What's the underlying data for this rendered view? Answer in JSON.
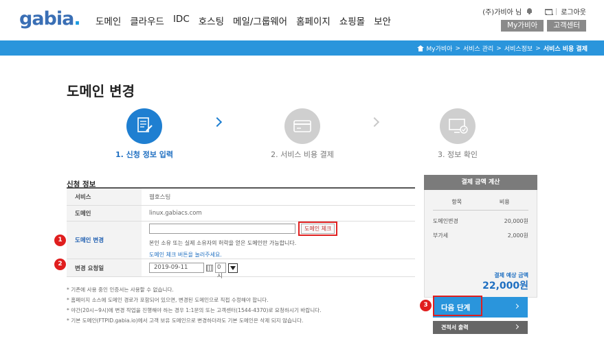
{
  "header": {
    "logo": "gabia",
    "logo_dot": ".",
    "nav": [
      "도메인",
      "클라우드",
      "IDC",
      "호스팅",
      "메일/그룹웨어",
      "홈페이지",
      "쇼핑몰",
      "보안"
    ],
    "user": "(주)가비아 님",
    "logout": "로그아웃",
    "my_button": "My가비아",
    "support_button": "고객센터"
  },
  "breadcrumb": [
    "My가비아",
    ">",
    "서비스 관리",
    ">",
    "서비스정보",
    ">",
    "서비스 비용 결제"
  ],
  "page_title": "도메인 변경",
  "steps": [
    {
      "label": "1. 신청 정보 입력",
      "icon": "form-edit-icon",
      "active": true
    },
    {
      "label": "2. 서비스 비용 결제",
      "icon": "card-payment-icon",
      "active": false
    },
    {
      "label": "3. 정보 확인",
      "icon": "monitor-check-icon",
      "active": false
    }
  ],
  "form": {
    "section_title": "신청 정보",
    "service_label": "서비스",
    "service_value": "웹호스팅",
    "domain_label": "도메인",
    "domain_value": "linux.gabiacs.com",
    "change_label": "도메인 변경",
    "change_input_value": "",
    "check_button": "도메인 체크",
    "help_text": "본인 소유 또는 실제 소유자의 허락을 얻은 도메인만 가능합니다.",
    "help_link": "도메인 체크 버튼을 눌러주세요.",
    "date_label": "변경 요청일",
    "date_value": "2019-09-11",
    "hour_value": "0시"
  },
  "badges": [
    "1",
    "2",
    "3"
  ],
  "notes": [
    "* 기존에 사용 중인 인증서는 사용할 수 없습니다.",
    "* 홈페이지 소스에 도메인 경로가 포함되어 있으면, 변경된 도메인으로 직접 수정해야 합니다.",
    "* 야간(20시~9시)에 변경 작업을 진행해야 하는 경우 1:1문의 또는 고객센터(1544-4370)로 요청하시기 바랍니다.",
    "* 기본 도메인(FTPID.gabia.io)에서 고객 보유 도메인으로 변경하더라도 기본 도메인은 삭제 되지 않습니다."
  ],
  "payment": {
    "title": "결제 금액 계산",
    "col_item": "항목",
    "col_cost": "비용",
    "rows": [
      {
        "item": "도메인변경",
        "cost": "20,000원"
      },
      {
        "item": "부가세",
        "cost": "2,000원"
      }
    ],
    "total_label": "결제 예상 금액",
    "total": "22,000원",
    "next_button": "다음 단계",
    "quote_button": "견적서 출력"
  },
  "colors": {
    "accent": "#2a95dc",
    "brand": "#3a6fb5",
    "badge": "#e01e1e"
  }
}
